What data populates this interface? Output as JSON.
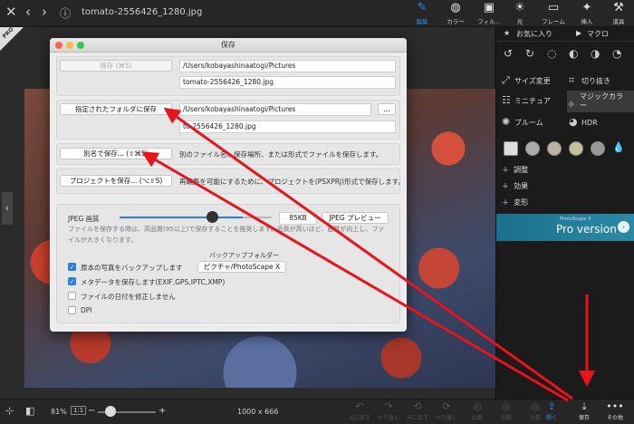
{
  "topbar": {
    "filename": "tomato-2556426_1280.jpg",
    "tools": [
      "編集",
      "カラー",
      "フィル...",
      "光",
      "フレーム",
      "挿入",
      "道具"
    ]
  },
  "canvas": {
    "pro_badge": "PRO"
  },
  "right_panel": {
    "tabs": {
      "favorites": "お気に入り",
      "macro": "マクロ"
    },
    "features": {
      "resize": "サイズ変更",
      "crop": "切り抜き",
      "miniature": "ミニチュア",
      "magic_color": "マジックカラー",
      "bloom": "ブルーム",
      "hdr": "HDR"
    },
    "accordion": [
      "調整",
      "効果",
      "変形"
    ],
    "banner": {
      "small": "PhotoScape X",
      "big": "Pro version"
    }
  },
  "bottombar": {
    "zoom": "81%",
    "fit": "1:1",
    "dimensions": "1000 x 666",
    "tools": [
      "元に戻す",
      "やり直し",
      "元に戻す",
      "やり直し",
      "比較",
      "比較",
      "比較"
    ],
    "open": "開く",
    "save": "保存",
    "more": "その他"
  },
  "dialog": {
    "title": "保存",
    "save_button": "保存 (⌘S)",
    "current_path": "/Users/kobayashinaatogi/Pictures",
    "current_file": "tomato-2556426_1280.jpg",
    "folder_button": "指定されたフォルダに保存",
    "folder_path": "/Users/kobayashinaatogi/Pictures",
    "folder_file": "to-2556426_1280.jpg",
    "folder_browse": "...",
    "save_as_button": "別名で保存... (⇧⌘S)",
    "save_as_desc": "別のファイル名、保存場所、または形式でファイルを保存します。",
    "project_button": "プロジェクトを保存... (⌥⇧S)",
    "project_desc": "再編集を可能にするために、プロジェクトを(PSXPRJ)形式で保存します。",
    "jpeg_label": "JPEG 画質",
    "size_value": "85KB",
    "preview_button": "JPEG プレビュー",
    "jpeg_note": "ファイルを保存する時は、高品質(95以上)で保存することを推奨します。品質が高いほど、画質が向上し、ファイルが大きくなります。",
    "backup_folder_label": "バックアップフォルダー",
    "backup_folder_value": "ピクチャ/PhotoScape X",
    "options": [
      {
        "label": "原本の写真をバックアップします",
        "checked": true
      },
      {
        "label": "メタデータを保存します(EXIF,GPS,IPTC,XMP)",
        "checked": true
      },
      {
        "label": "ファイルの日付を修正しません",
        "checked": false
      },
      {
        "label": "DPI",
        "checked": false
      }
    ]
  }
}
